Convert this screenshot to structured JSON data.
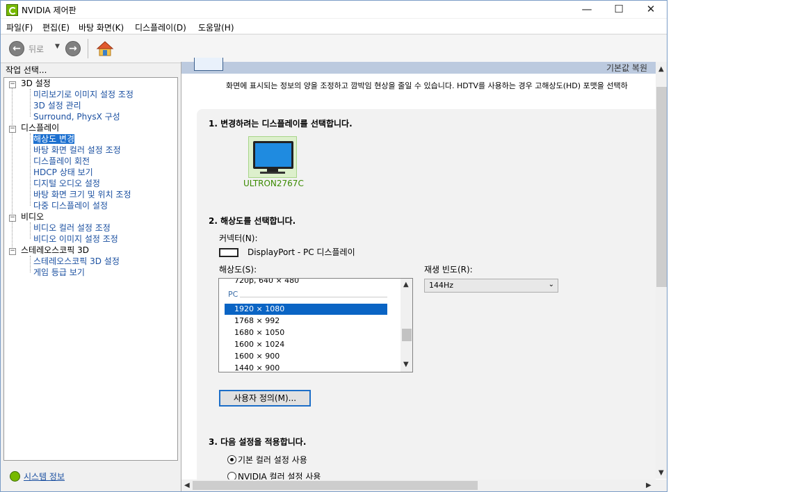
{
  "window": {
    "title": "NVIDIA 제어판",
    "minimize": "—",
    "maximize": "☐",
    "close": "✕"
  },
  "menu": [
    "파일(F)",
    "편집(E)",
    "바탕 화면(K)",
    "디스플레이(D)",
    "도움말(H)"
  ],
  "toolbar": {
    "back_label": "뒤로",
    "back_glyph": "←",
    "forward_glyph": "→",
    "dropdown_glyph": "▼"
  },
  "left": {
    "header": "작업 선택...",
    "tree": [
      {
        "label": "3D 설정",
        "type": "category"
      },
      {
        "label": "미리보기로 이미지 설정 조정",
        "type": "leaf"
      },
      {
        "label": "3D 설정 관리",
        "type": "leaf"
      },
      {
        "label": "Surround, PhysX 구성",
        "type": "leaf"
      },
      {
        "label": "디스플레이",
        "type": "category"
      },
      {
        "label": "해상도 변경",
        "type": "leaf",
        "selected": true
      },
      {
        "label": "바탕 화면 컬러 설정 조정",
        "type": "leaf"
      },
      {
        "label": "디스플레이 회전",
        "type": "leaf"
      },
      {
        "label": "HDCP 상태 보기",
        "type": "leaf"
      },
      {
        "label": "디지털 오디오 설정",
        "type": "leaf"
      },
      {
        "label": "바탕 화면 크기 및 위치 조정",
        "type": "leaf"
      },
      {
        "label": "다중 디스플레이 설정",
        "type": "leaf"
      },
      {
        "label": "비디오",
        "type": "category"
      },
      {
        "label": "비디오 컬러 설정 조정",
        "type": "leaf"
      },
      {
        "label": "비디오 이미지 설정 조정",
        "type": "leaf"
      },
      {
        "label": "스테레오스코픽 3D",
        "type": "category"
      },
      {
        "label": "스테레오스코픽 3D 설정",
        "type": "leaf"
      },
      {
        "label": "게임 등급 보기",
        "type": "leaf"
      }
    ],
    "expander_glyph": "−",
    "system_info": "시스템 정보"
  },
  "main": {
    "restore_defaults": "기본값 복원",
    "description": "화면에 표시되는 정보의 양을 조정하고 깜박임 현상을 줄일 수 있습니다. HDTV를 사용하는 경우 고해상도(HD) 포맷을 선택하",
    "section1": "1. 변경하려는 디스플레이를 선택합니다.",
    "display_name": "ULTRON2767C",
    "section2": "2. 해상도를 선택합니다.",
    "connector_label": "커넥터(N):",
    "connector_value": "DisplayPort - PC 디스플레이",
    "resolution_label": "해상도(S):",
    "resolution_partial": "720p, 640 × 480",
    "resolution_group": "PC",
    "resolutions": [
      "1920 × 1080",
      "1768 × 992",
      "1680 × 1050",
      "1600 × 1024",
      "1600 × 900",
      "1440 × 900"
    ],
    "refresh_label": "재생 빈도(R):",
    "refresh_value": "144Hz",
    "customize_button": "사용자 정의(M)...",
    "section3": "3. 다음 설정을 적용합니다.",
    "radio1": "기본 컬러 설정 사용",
    "radio2": "NVIDIA 컬러 설정 사용",
    "scroll_up": "▲",
    "scroll_down": "▼",
    "scroll_left": "◀",
    "scroll_right": "▶",
    "combo_arrow": "⌄"
  }
}
